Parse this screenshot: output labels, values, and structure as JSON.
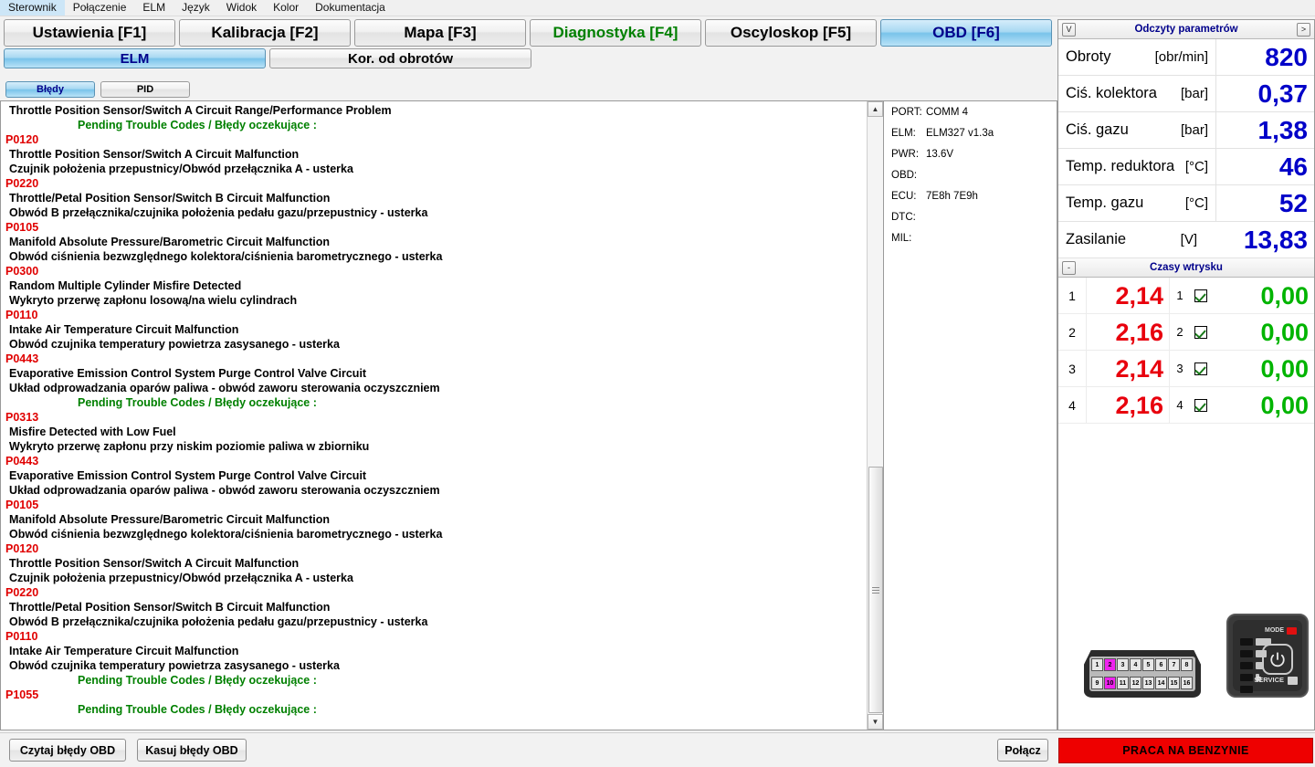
{
  "menu": {
    "items": [
      "Sterownik",
      "Połączenie",
      "ELM",
      "Język",
      "Widok",
      "Kolor",
      "Dokumentacja"
    ]
  },
  "tabs": [
    {
      "label": "Ustawienia [F1]",
      "state": "normal"
    },
    {
      "label": "Kalibracja [F2]",
      "state": "normal"
    },
    {
      "label": "Mapa [F3]",
      "state": "normal"
    },
    {
      "label": "Diagnostyka [F4]",
      "state": "green"
    },
    {
      "label": "Oscyloskop [F5]",
      "state": "normal"
    },
    {
      "label": "OBD [F6]",
      "state": "active"
    }
  ],
  "subtabs": [
    {
      "label": "ELM",
      "state": "active"
    },
    {
      "label": "Kor. od obrotów",
      "state": "normal"
    }
  ],
  "modetabs": [
    {
      "label": "Błędy",
      "state": "active"
    },
    {
      "label": "PID",
      "state": "normal"
    }
  ],
  "dtc_list": [
    {
      "type": "en",
      "text": "Throttle Position Sensor/Switch A Circuit Range/Performance Problem"
    },
    {
      "type": "pending",
      "text": "Pending Trouble Codes  /  Błędy oczekujące :"
    },
    {
      "type": "code",
      "text": "P0120"
    },
    {
      "type": "en",
      "text": "Throttle Position Sensor/Switch A Circuit Malfunction"
    },
    {
      "type": "pl",
      "text": "Czujnik położenia przepustnicy/Obwód przełącznika A - usterka"
    },
    {
      "type": "code",
      "text": "P0220"
    },
    {
      "type": "en",
      "text": "Throttle/Petal Position Sensor/Switch B Circuit Malfunction"
    },
    {
      "type": "pl",
      "text": "Obwód B przełącznika/czujnika położenia pedału gazu/przepustnicy - usterka"
    },
    {
      "type": "code",
      "text": "P0105"
    },
    {
      "type": "en",
      "text": "Manifold Absolute Pressure/Barometric Circuit Malfunction"
    },
    {
      "type": "pl",
      "text": "Obwód ciśnienia bezwzględnego kolektora/ciśnienia barometrycznego - usterka"
    },
    {
      "type": "code",
      "text": "P0300"
    },
    {
      "type": "en",
      "text": "Random Multiple Cylinder Misfire Detected"
    },
    {
      "type": "pl",
      "text": "Wykryto przerwę zapłonu losową/na wielu cylindrach"
    },
    {
      "type": "code",
      "text": "P0110"
    },
    {
      "type": "en",
      "text": "Intake Air Temperature Circuit Malfunction"
    },
    {
      "type": "pl",
      "text": "Obwód czujnika temperatury powietrza zasysanego - usterka"
    },
    {
      "type": "code",
      "text": "P0443"
    },
    {
      "type": "en",
      "text": "Evaporative Emission Control System Purge Control Valve Circuit"
    },
    {
      "type": "pl",
      "text": "Układ odprowadzania oparów paliwa - obwód zaworu sterowania oczyszczniem"
    },
    {
      "type": "pending",
      "text": "Pending Trouble Codes  /  Błędy oczekujące :"
    },
    {
      "type": "code",
      "text": "P0313"
    },
    {
      "type": "en",
      "text": "Misfire Detected with Low Fuel"
    },
    {
      "type": "pl",
      "text": "Wykryto przerwę zapłonu przy niskim poziomie paliwa w zbiorniku"
    },
    {
      "type": "code",
      "text": "P0443"
    },
    {
      "type": "en",
      "text": "Evaporative Emission Control System Purge Control Valve Circuit"
    },
    {
      "type": "pl",
      "text": "Układ odprowadzania oparów paliwa - obwód zaworu sterowania oczyszczniem"
    },
    {
      "type": "code",
      "text": "P0105"
    },
    {
      "type": "en",
      "text": "Manifold Absolute Pressure/Barometric Circuit Malfunction"
    },
    {
      "type": "pl",
      "text": "Obwód ciśnienia bezwzględnego kolektora/ciśnienia barometrycznego - usterka"
    },
    {
      "type": "code",
      "text": "P0120"
    },
    {
      "type": "en",
      "text": "Throttle Position Sensor/Switch A Circuit Malfunction"
    },
    {
      "type": "pl",
      "text": "Czujnik położenia przepustnicy/Obwód przełącznika A - usterka"
    },
    {
      "type": "code",
      "text": "P0220"
    },
    {
      "type": "en",
      "text": "Throttle/Petal Position Sensor/Switch B Circuit Malfunction"
    },
    {
      "type": "pl",
      "text": "Obwód B przełącznika/czujnika położenia pedału gazu/przepustnicy - usterka"
    },
    {
      "type": "code",
      "text": "P0110"
    },
    {
      "type": "en",
      "text": "Intake Air Temperature Circuit Malfunction"
    },
    {
      "type": "pl",
      "text": "Obwód czujnika temperatury powietrza zasysanego - usterka"
    },
    {
      "type": "pending",
      "text": "Pending Trouble Codes  /  Błędy oczekujące :"
    },
    {
      "type": "code",
      "text": "P1055"
    },
    {
      "type": "pending",
      "text": "Pending Trouble Codes  /  Błędy oczekujące :"
    }
  ],
  "port_info": [
    {
      "key": "PORT:",
      "value": "COMM 4"
    },
    {
      "key": "ELM:",
      "value": "ELM327 v1.3a"
    },
    {
      "key": "PWR:",
      "value": "13.6V"
    },
    {
      "key": "OBD:",
      "value": ""
    },
    {
      "key": "ECU:",
      "value": "7E8h 7E9h"
    },
    {
      "key": "DTC:",
      "value": ""
    },
    {
      "key": "MIL:",
      "value": ""
    }
  ],
  "params_panel": {
    "title": "Odczyty parametrów",
    "collapse_icon": "V",
    "expand_icon": ">",
    "rows": [
      {
        "label": "Obroty",
        "unit": "[obr/min]",
        "value": "820"
      },
      {
        "label": "Ciś. kolektora",
        "unit": "[bar]",
        "value": "0,37"
      },
      {
        "label": "Ciś. gazu",
        "unit": "[bar]",
        "value": "1,38"
      },
      {
        "label": "Temp. reduktora",
        "unit": "[°C]",
        "value": "46"
      },
      {
        "label": "Temp. gazu",
        "unit": "[°C]",
        "value": "52"
      },
      {
        "label": "Zasilanie",
        "unit": "[V]",
        "value": "13,83"
      }
    ]
  },
  "injection_panel": {
    "title": "Czasy wtrysku",
    "collapse_icon": "-",
    "rows": [
      {
        "index": "1",
        "petrol_ms": "2,14",
        "index2": "1",
        "checked": true,
        "gas_ms": "0,00"
      },
      {
        "index": "2",
        "petrol_ms": "2,16",
        "index2": "2",
        "checked": true,
        "gas_ms": "0,00"
      },
      {
        "index": "3",
        "petrol_ms": "2,14",
        "index2": "3",
        "checked": true,
        "gas_ms": "0,00"
      },
      {
        "index": "4",
        "petrol_ms": "2,16",
        "index2": "4",
        "checked": true,
        "gas_ms": "0,00"
      }
    ]
  },
  "obd_connector": {
    "top_pins": [
      "1",
      "2",
      "3",
      "4",
      "5",
      "6",
      "7",
      "8"
    ],
    "bottom_pins": [
      "9",
      "10",
      "11",
      "12",
      "13",
      "14",
      "15",
      "16"
    ],
    "highlighted": [
      "2",
      "10"
    ]
  },
  "lpg_switch": {
    "mode_label": "MODE",
    "service_label": "SERVICE",
    "reserve_label": "R"
  },
  "bottom": {
    "read_label": "Czytaj błędy OBD",
    "clear_label": "Kasuj błędy OBD",
    "connect_label": "Połącz",
    "status_text": "PRACA NA BENZYNIE"
  }
}
